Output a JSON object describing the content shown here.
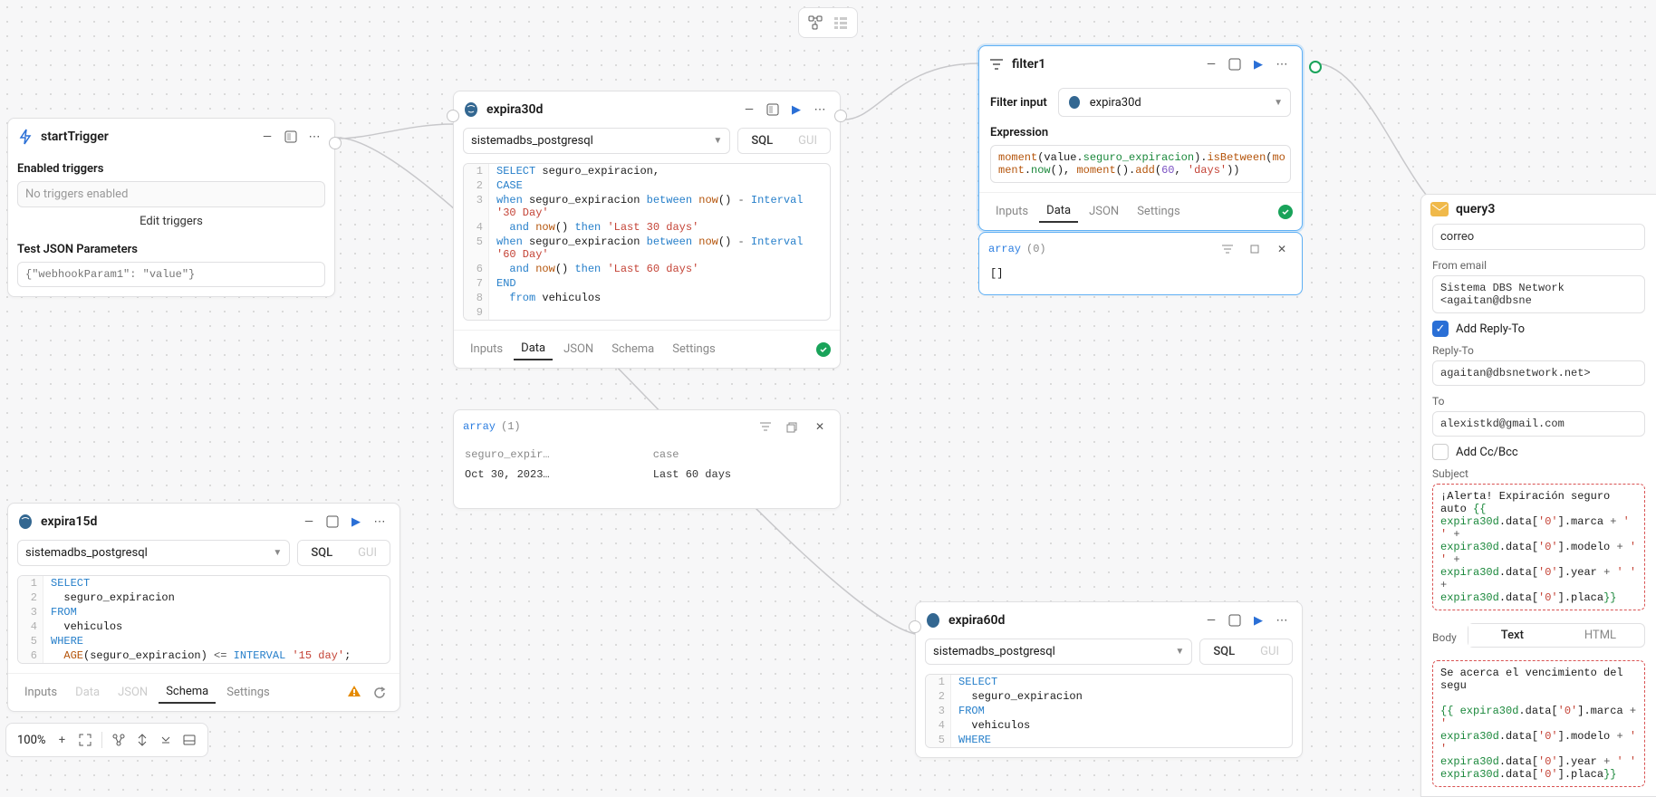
{
  "top_toolbar": {
    "icon_a": "nodes",
    "icon_b": "list"
  },
  "startTrigger": {
    "title": "startTrigger",
    "enabled_label": "Enabled triggers",
    "none_msg": "No triggers enabled",
    "edit_label": "Edit triggers",
    "test_params_label": "Test JSON Parameters",
    "test_params_placeholder": "{\"webhookParam1\": \"value\"}"
  },
  "expira30d": {
    "title": "expira30d",
    "resource": "sistemadbs_postgresql",
    "modes": {
      "sql": "SQL",
      "gui": "GUI"
    },
    "code": [
      {
        "n": 1,
        "html": "<span class='kw'>SELECT</span> seguro_expiracion,"
      },
      {
        "n": 2,
        "html": "<span class='kw'>CASE</span>"
      },
      {
        "n": 3,
        "html": "<span class='kw'>when</span> seguro_expiracion <span class='kw'>between</span> <span class='fn'>now</span>() <span class='op'>-</span> <span class='kw'>Interval</span> <span class='str'>'30 Day'</span>"
      },
      {
        "n": 4,
        "html": "  <span class='kw'>and</span> <span class='fn'>now</span>() <span class='kw'>then</span> <span class='str'>'Last 30 days'</span>"
      },
      {
        "n": 5,
        "html": "<span class='kw'>when</span> seguro_expiracion <span class='kw'>between</span> <span class='fn'>now</span>() <span class='op'>-</span> <span class='kw'>Interval</span> <span class='str'>'60 Day'</span>"
      },
      {
        "n": 6,
        "html": "  <span class='kw'>and</span> <span class='fn'>now</span>() <span class='kw'>then</span> <span class='str'>'Last 60 days'</span>"
      },
      {
        "n": 7,
        "html": "<span class='kw'>END</span>"
      },
      {
        "n": 8,
        "html": "  <span class='kw'>from</span> vehiculos"
      },
      {
        "n": 9,
        "html": ""
      }
    ],
    "tabs": {
      "inputs": "Inputs",
      "data": "Data",
      "json": "JSON",
      "schema": "Schema",
      "settings": "Settings"
    },
    "result_head": "array (1)",
    "result_cols": [
      "seguro_expir…",
      "case"
    ],
    "result_row": [
      "Oct 30, 2023…",
      "Last 60 days"
    ]
  },
  "expira15d": {
    "title": "expira15d",
    "resource": "sistemadbs_postgresql",
    "modes": {
      "sql": "SQL",
      "gui": "GUI"
    },
    "code": [
      {
        "n": 1,
        "html": "<span class='kw'>SELECT</span>"
      },
      {
        "n": 2,
        "html": "  seguro_expiracion"
      },
      {
        "n": 3,
        "html": "<span class='kw'>FROM</span>"
      },
      {
        "n": 4,
        "html": "  vehiculos"
      },
      {
        "n": 5,
        "html": "<span class='kw'>WHERE</span>"
      },
      {
        "n": 6,
        "html": "  <span class='fn'>AGE</span>(seguro_expiracion) <span class='op'>&lt;=</span> <span class='kw'>INTERVAL</span> <span class='str'>'15 day'</span>;"
      }
    ],
    "tabs": {
      "inputs": "Inputs",
      "data": "Data",
      "json": "JSON",
      "schema": "Schema",
      "settings": "Settings"
    }
  },
  "filter1": {
    "title": "filter1",
    "input_label": "Filter input",
    "input_value": "expira30d",
    "expr_label": "Expression",
    "expr_html": "<span class='fn'>moment</span>(value.<span class='prop'>seguro_expiracion</span>).<span class='fn'>isBetween</span>(<span class='fn'>mo<br>ment</span>.<span class='prop'>now</span>(), <span class='fn'>moment</span>().<span class='fn'>add</span>(<span class='num'>60</span>, <span class='str'>'days'</span>))",
    "tabs": {
      "inputs": "Inputs",
      "data": "Data",
      "json": "JSON",
      "settings": "Settings"
    },
    "result_head": "array (0)",
    "result_body": "[]"
  },
  "expira60d": {
    "title": "expira60d",
    "resource": "sistemadbs_postgresql",
    "modes": {
      "sql": "SQL",
      "gui": "GUI"
    },
    "code": [
      {
        "n": 1,
        "html": "<span class='kw'>SELECT</span>"
      },
      {
        "n": 2,
        "html": "  seguro_expiracion"
      },
      {
        "n": 3,
        "html": "<span class='kw'>FROM</span>"
      },
      {
        "n": 4,
        "html": "  vehiculos"
      },
      {
        "n": 5,
        "html": "<span class='kw'>WHERE</span>"
      }
    ]
  },
  "query3": {
    "title": "query3",
    "correo_label": "correo",
    "from_label": "From email",
    "from_value": "Sistema DBS Network <agaitan@dbsne",
    "add_reply_label": "Add Reply-To",
    "reply_label": "Reply-To",
    "reply_value": "agaitan@dbsnetwork.net>",
    "to_label": "To",
    "to_value": "alexistkd@gmail.com",
    "add_cc_label": "Add Cc/Bcc",
    "subject_label": "Subject",
    "subject_html": "¡Alerta! Expiración seguro auto <span class='prop'>{{</span><br><span class='prop'>expira30d</span>.data[<span class='str'>'0'</span>].marca <span class='op'>+</span> <span class='str'>' '</span> <span class='op'>+</span><br><span class='prop'>expira30d</span>.data[<span class='str'>'0'</span>].modelo <span class='op'>+</span> <span class='str'>' '</span> <span class='op'>+</span><br><span class='prop'>expira30d</span>.data[<span class='str'>'0'</span>].year <span class='op'>+</span> <span class='str'>' '</span> <span class='op'>+</span><br><span class='prop'>expira30d</span>.data[<span class='str'>'0'</span>].placa<span class='prop'>}}</span>",
    "body_label": "Body",
    "body_tabs": {
      "text": "Text",
      "html": "HTML"
    },
    "body_html": "Se acerca el vencimiento del segu<br><br><span class='prop'>{{ expira30d</span>.data[<span class='str'>'0'</span>].marca <span class='op'>+</span> <span class='str'>'</span><br><span class='prop'>expira30d</span>.data[<span class='str'>'0'</span>].modelo <span class='op'>+</span> <span class='str'>' '</span><br><span class='prop'>expira30d</span>.data[<span class='str'>'0'</span>].year <span class='op'>+</span> <span class='str'>' '</span><br><span class='prop'>expira30d</span>.data[<span class='str'>'0'</span>].placa<span class='prop'>}}</span>"
  },
  "zoom": "100%"
}
